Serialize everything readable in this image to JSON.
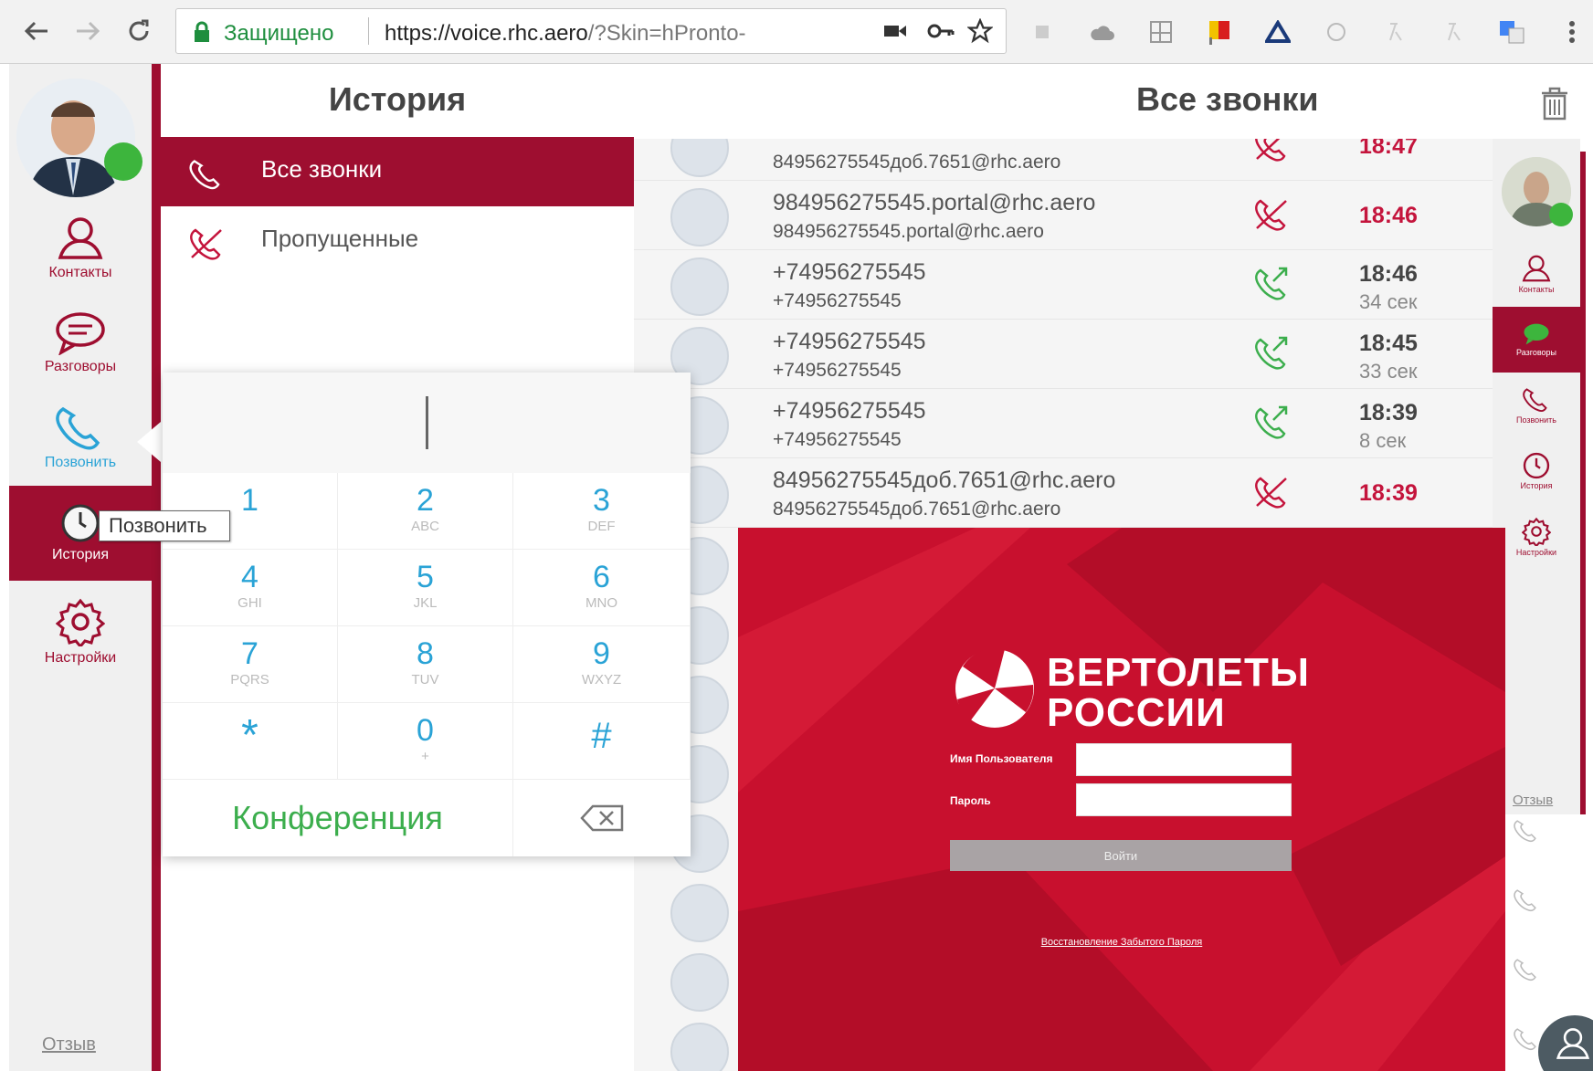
{
  "browser": {
    "secure_label": "Защищено",
    "url_main": "https://voice.rhc.aero",
    "url_rest": "/?Skin=hPronto-"
  },
  "sidebar": {
    "items": [
      {
        "label": "Контакты",
        "icon": "user-icon"
      },
      {
        "label": "Разговоры",
        "icon": "chat-icon"
      },
      {
        "label": "Позвонить",
        "icon": "phone-icon"
      },
      {
        "label": "История",
        "icon": "clock-icon"
      },
      {
        "label": "Настройки",
        "icon": "gear-icon"
      }
    ],
    "tooltip": "Позвонить",
    "feedback": "Отзыв"
  },
  "history": {
    "title": "История",
    "items": [
      {
        "label": "Все звонки"
      },
      {
        "label": "Пропущенные"
      }
    ]
  },
  "calls": {
    "title": "Все звонки",
    "rows": [
      {
        "name": "",
        "sub": "84956275545доб.7651@rhc.aero",
        "time": "18:47",
        "duration": "",
        "kind": "missed"
      },
      {
        "name": "984956275545.portal@rhc.aero",
        "sub": "984956275545.portal@rhc.aero",
        "time": "18:46",
        "duration": "",
        "kind": "missed"
      },
      {
        "name": "+74956275545",
        "sub": "+74956275545",
        "time": "18:46",
        "duration": "34 сек",
        "kind": "outgoing"
      },
      {
        "name": "+74956275545",
        "sub": "+74956275545",
        "time": "18:45",
        "duration": "33 сек",
        "kind": "outgoing"
      },
      {
        "name": "+74956275545",
        "sub": "+74956275545",
        "time": "18:39",
        "duration": "8 сек",
        "kind": "outgoing"
      },
      {
        "name": "84956275545доб.7651@rhc.aero",
        "sub": "84956275545доб.7651@rhc.aero",
        "time": "18:39",
        "duration": "",
        "kind": "missed"
      }
    ]
  },
  "dialpad": {
    "keys": [
      {
        "digit": "1",
        "letters": ""
      },
      {
        "digit": "2",
        "letters": "ABC"
      },
      {
        "digit": "3",
        "letters": "DEF"
      },
      {
        "digit": "4",
        "letters": "GHI"
      },
      {
        "digit": "5",
        "letters": "JKL"
      },
      {
        "digit": "6",
        "letters": "MNO"
      },
      {
        "digit": "7",
        "letters": "PQRS"
      },
      {
        "digit": "8",
        "letters": "TUV"
      },
      {
        "digit": "9",
        "letters": "WXYZ"
      },
      {
        "digit": "*",
        "letters": ""
      },
      {
        "digit": "0",
        "letters": "+"
      },
      {
        "digit": "#",
        "letters": ""
      }
    ],
    "conference": "Конференция"
  },
  "mini_sidebar": {
    "items": [
      {
        "label": "Контакты"
      },
      {
        "label": "Разговоры"
      },
      {
        "label": "Позвонить"
      },
      {
        "label": "История"
      },
      {
        "label": "Настройки"
      }
    ],
    "feedback": "Отзыв"
  },
  "login": {
    "brand_line1": "ВЕРТОЛЕТЫ",
    "brand_line2": "РОССИИ",
    "username_label": "Имя Пользователя",
    "password_label": "Пароль",
    "submit": "Войти",
    "forgot": "Восстановление Забытого Пароля"
  },
  "colors": {
    "brand": "#9e0e30",
    "login_bg": "#c8102e",
    "accent_blue": "#2aa3d6",
    "accent_green": "#3cae4d",
    "missed": "#c4143c"
  }
}
